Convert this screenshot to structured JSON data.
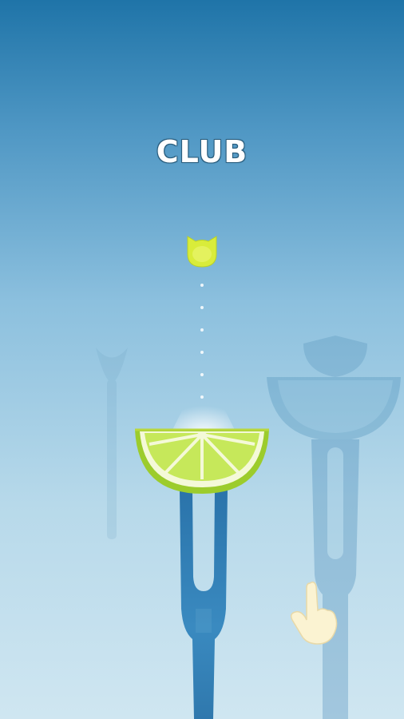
{
  "game": {
    "title": "CLUB",
    "colors": {
      "sky_top": "#1f74a8",
      "sky_bottom": "#cfe6f1",
      "fork": "#2f78ad",
      "lime_rind": "#9ccc2c",
      "lime_flesh": "#c6e85a",
      "ball": "#d9ec3a"
    },
    "icons": {
      "ball": "cat-head-lime-ball-icon",
      "hint": "pointing-hand-icon"
    }
  }
}
